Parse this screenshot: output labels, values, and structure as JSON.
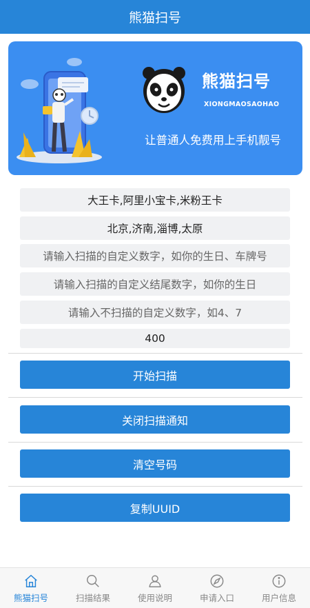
{
  "header": {
    "title": "熊猫扫号"
  },
  "banner": {
    "brand_name": "熊猫扫号",
    "brand_pinyin": "XIONGMAOSAOHAO",
    "slogan": "让普通人免费用上手机靓号"
  },
  "form": {
    "card_types": "大王卡,阿里小宝卡,米粉王卡",
    "cities": "北京,济南,淄博,太原",
    "custom_digits_placeholder": "请输入扫描的自定义数字，如你的生日、车牌号",
    "custom_ending_placeholder": "请输入扫描的自定义结尾数字，如你的生日",
    "exclude_digits_placeholder": "请输入不扫描的自定义数字，如4、7",
    "count": "400"
  },
  "buttons": {
    "start_scan": "开始扫描",
    "close_notify": "关闭扫描通知",
    "clear_numbers": "清空号码",
    "copy_uuid": "复制UUID"
  },
  "tabs": [
    {
      "label": "熊猫扫号",
      "icon": "home-icon",
      "active": true
    },
    {
      "label": "扫描结果",
      "icon": "search-icon",
      "active": false
    },
    {
      "label": "使用说明",
      "icon": "user-icon",
      "active": false
    },
    {
      "label": "申请入口",
      "icon": "navigation-icon",
      "active": false
    },
    {
      "label": "用户信息",
      "icon": "info-icon",
      "active": false
    }
  ],
  "colors": {
    "primary": "#2785d8",
    "banner": "#3b8ef1",
    "field_bg": "#f0f1f3"
  }
}
